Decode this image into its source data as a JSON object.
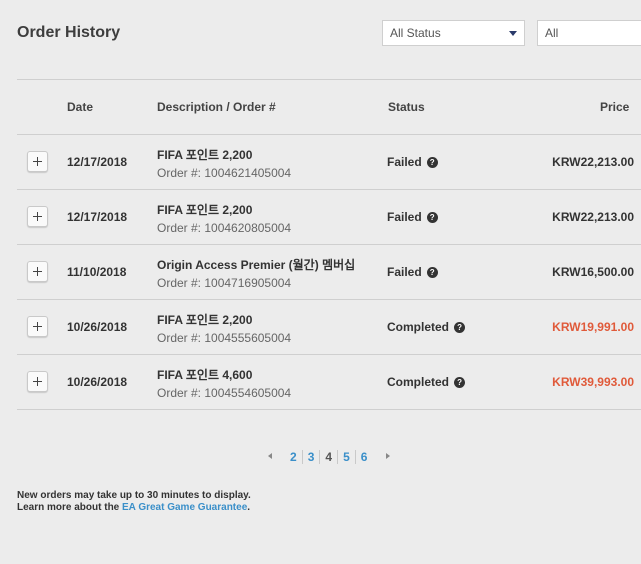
{
  "header": {
    "title": "Order History",
    "status_filter": "All Status",
    "second_filter": "All"
  },
  "table": {
    "columns": {
      "date": "Date",
      "description": "Description / Order #",
      "status": "Status",
      "price": "Price"
    },
    "rows": [
      {
        "date": "12/17/2018",
        "description": "FIFA 포인트 2,200",
        "order": "Order #: 1004621405004",
        "status": "Failed",
        "price": "KRW22,213.00"
      },
      {
        "date": "12/17/2018",
        "description": "FIFA 포인트 2,200",
        "order": "Order #: 1004620805004",
        "status": "Failed",
        "price": "KRW22,213.00"
      },
      {
        "date": "11/10/2018",
        "description": "Origin Access Premier (월간) 멤버십",
        "order": "Order #: 1004716905004",
        "status": "Failed",
        "price": "KRW16,500.00"
      },
      {
        "date": "10/26/2018",
        "description": "FIFA 포인트 2,200",
        "order": "Order #: 1004555605004",
        "status": "Completed",
        "price": "KRW19,991.00"
      },
      {
        "date": "10/26/2018",
        "description": "FIFA 포인트 4,600",
        "order": "Order #: 1004554605004",
        "status": "Completed",
        "price": "KRW39,993.00"
      }
    ]
  },
  "pagination": {
    "pages": [
      "2",
      "3",
      "4",
      "5",
      "6"
    ],
    "current": "4"
  },
  "footer": {
    "line1": "New orders may take up to 30 minutes to display.",
    "line2_prefix": "Learn more about the ",
    "line2_link": "EA Great Game Guarantee",
    "line2_suffix": "."
  },
  "colors": {
    "background": "#ececec",
    "completed_price": "#e05a3a",
    "link": "#3a8fc9"
  },
  "icons": {
    "expand": "plus-icon",
    "status_help": "question-circle-icon",
    "dropdown": "caret-down-icon",
    "prev_page": "triangle-left-icon",
    "next_page": "triangle-right-icon"
  }
}
